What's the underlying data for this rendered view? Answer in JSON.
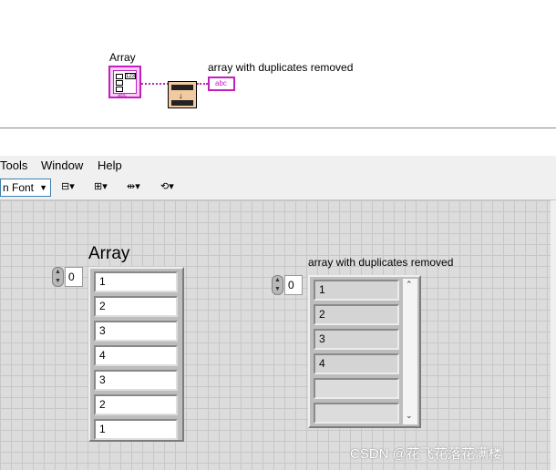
{
  "block_diagram": {
    "control_label": "Array",
    "indicator_label": "array with duplicates removed",
    "control_tag": "123",
    "control_type": "abc",
    "indicator_type": "abc"
  },
  "menu": [
    "Tools",
    "Window",
    "Help"
  ],
  "toolbar": {
    "font_label": "n Font"
  },
  "front_panel": {
    "input_array": {
      "label": "Array",
      "index": "0",
      "values": [
        "1",
        "2",
        "3",
        "4",
        "3",
        "2",
        "1"
      ]
    },
    "output_array": {
      "label": "array with duplicates removed",
      "index": "0",
      "values": [
        "1",
        "2",
        "3",
        "4",
        "",
        ""
      ]
    }
  },
  "watermark": "CSDN @花飞花落花满楼",
  "colors": {
    "wire": "#c21fc1",
    "vi_node": "#f2c9a0",
    "panel_bg": "#dcdcdc"
  }
}
